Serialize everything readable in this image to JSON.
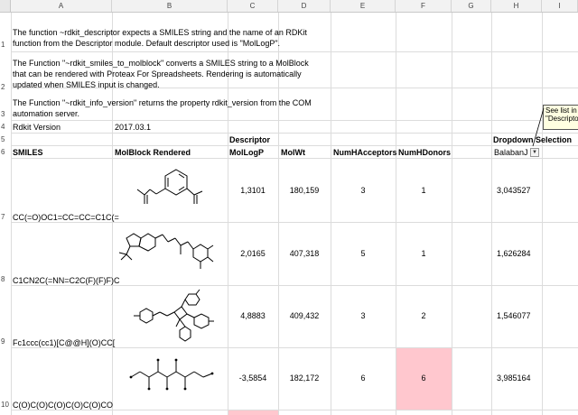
{
  "columns": [
    "A",
    "B",
    "C",
    "D",
    "E",
    "F",
    "G",
    "H",
    "I"
  ],
  "rows": [
    "1",
    "2",
    "3",
    "4",
    "5",
    "6",
    "7",
    "8",
    "9",
    "10"
  ],
  "notes": {
    "row1": "The function ~rdkit_descriptor expects a SMILES string and the name of an RDKit function from the Descriptor module. Default descriptor used is \"MolLogP\".",
    "row2": "The Function \"~rdkit_smiles_to_molblock\" converts a SMILES string to a MolBlock that can be rendered with Proteax For Spreadsheets. Rendering is automatically updated when SMILES input is changed.",
    "row3": "The Function \"~rdkit_info_version\" returns the property rdkit_version from the COM automation server."
  },
  "version": {
    "label": "Rdkit Version",
    "value": "2017.03.1"
  },
  "headers": {
    "descriptor": "Descriptor",
    "dropdown_selection": "Dropdown Selection",
    "smiles": "SMILES",
    "molblock": "MolBlock Rendered",
    "mollogp": "MolLogP",
    "molwt": "MolWt",
    "numhacceptors": "NumHAcceptors",
    "numhdonors": "NumHDonors",
    "dropdown_value": "BalabanJ"
  },
  "comment": {
    "text": "See list in \"Descripto"
  },
  "data_rows": [
    {
      "smiles": "CC(=O)OC1=CC=CC=C1C(=",
      "mollogp": "1,3101",
      "molwt": "180,159",
      "acceptors": "3",
      "donors": "1",
      "dropdown": "3,043527"
    },
    {
      "smiles": "C1CN2C(=NN=C2C(F)(F)F)C",
      "mollogp": "2,0165",
      "molwt": "407,318",
      "acceptors": "5",
      "donors": "1",
      "dropdown": "1,626284"
    },
    {
      "smiles": "Fc1ccc(cc1)[C@@H](O)CC[",
      "mollogp": "4,8883",
      "molwt": "409,432",
      "acceptors": "3",
      "donors": "2",
      "dropdown": "1,546077"
    },
    {
      "smiles": "C(O)C(O)C(O)C(O)C(O)CO",
      "mollogp": "-3,5854",
      "molwt": "182,172",
      "acceptors": "6",
      "donors": "6",
      "dropdown": "3,985164"
    }
  ],
  "colors": {
    "highlight": "#ffc7ce",
    "grid": "#dcdcdc"
  }
}
